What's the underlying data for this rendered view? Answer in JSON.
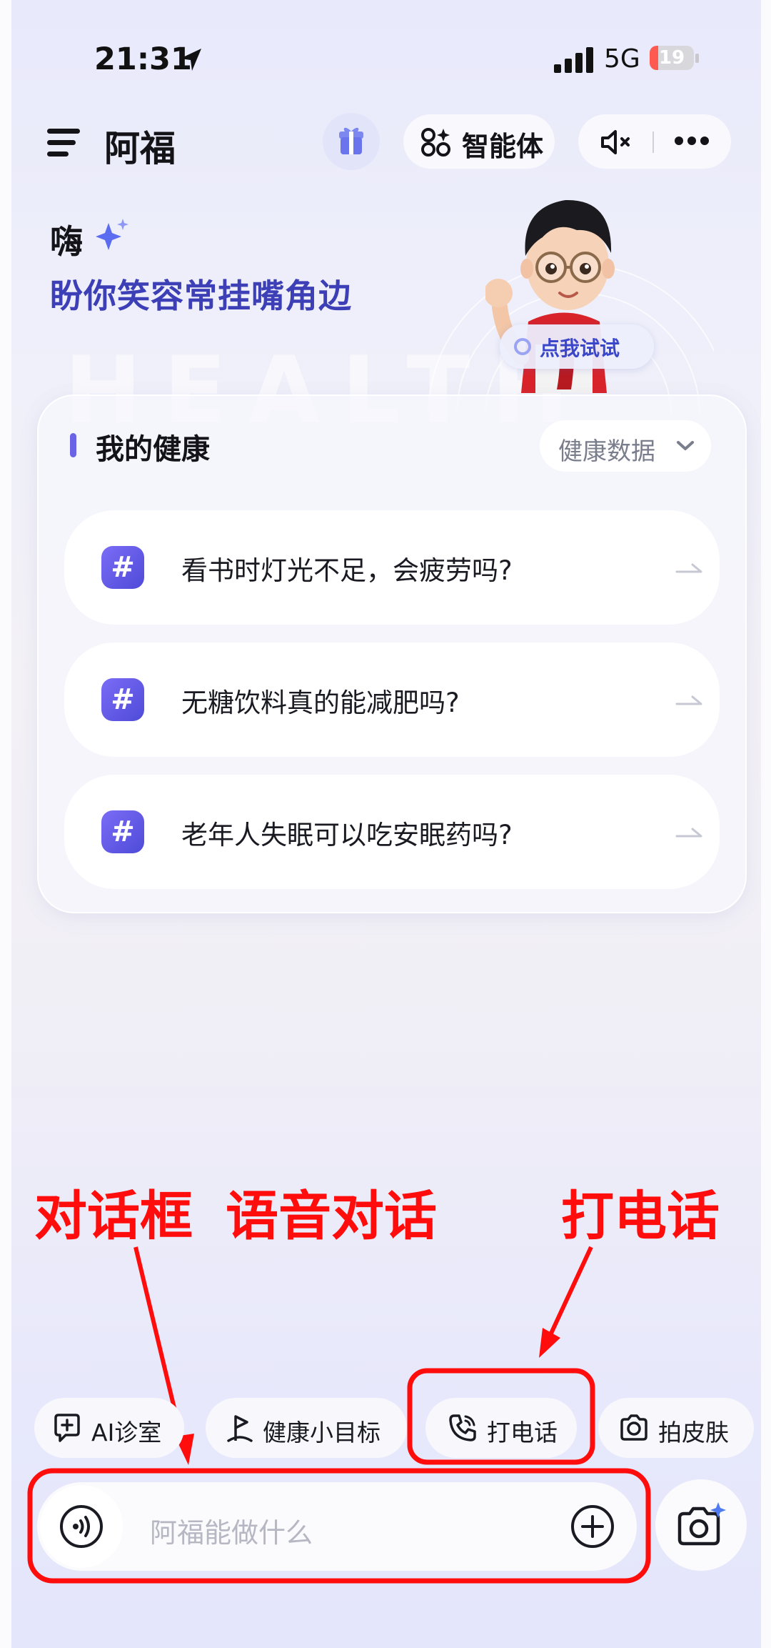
{
  "status_bar": {
    "time": "21:31",
    "network": "5G",
    "battery": "19",
    "battery_level": 0.19
  },
  "header": {
    "app_name": "阿福",
    "agent_label": "智能体"
  },
  "greeting": {
    "hi": "嗨",
    "slogan": "盼你笑容常挂嘴角边",
    "try_me": "点我试试",
    "watermark": "HEALTH"
  },
  "health_card": {
    "title": "我的健康",
    "data_button": "健康数据",
    "questions": [
      {
        "icon": "#",
        "text": "看书时灯光不足，会疲劳吗?"
      },
      {
        "icon": "#",
        "text": "无糖饮料真的能减肥吗?"
      },
      {
        "icon": "#",
        "text": "老年人失眠可以吃安眠药吗?"
      }
    ]
  },
  "annotations": {
    "dialog_box": "对话框",
    "voice_chat": "语音对话",
    "phone_call": "打电话"
  },
  "quick_actions": [
    {
      "icon": "chat-plus-icon",
      "label": "AI诊室"
    },
    {
      "icon": "flag-icon",
      "label": "健康小目标"
    },
    {
      "icon": "phone-icon",
      "label": "打电话"
    },
    {
      "icon": "camera-icon",
      "label": "拍皮肤"
    }
  ],
  "input": {
    "placeholder": "阿福能做什么"
  },
  "colors": {
    "accent": "#5b4fe0",
    "annotation_red": "#ff0d0d",
    "slogan": "#3c3fb5"
  }
}
